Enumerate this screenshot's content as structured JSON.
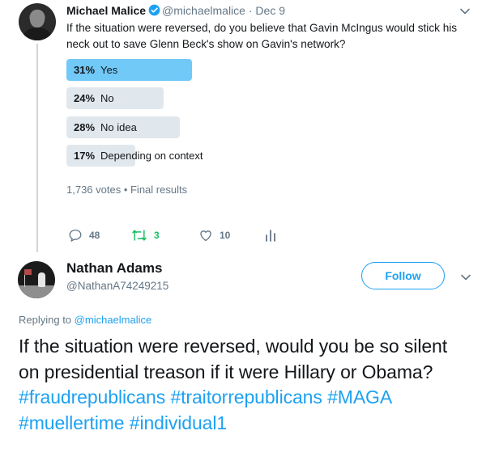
{
  "tweet1": {
    "author_name": "Michael Malice",
    "handle": "@michaelmalice",
    "separator": "·",
    "date": "Dec 9",
    "text": "If the situation were reversed, do you believe that Gavin McIngus would stick his neck out to save Glenn Beck's show on Gavin's network?",
    "poll": {
      "options": [
        {
          "percent": "31%",
          "label": "Yes",
          "fraction": 0.31,
          "winner": true
        },
        {
          "percent": "24%",
          "label": "No",
          "fraction": 0.24,
          "winner": false
        },
        {
          "percent": "28%",
          "label": "No idea",
          "fraction": 0.28,
          "winner": false
        },
        {
          "percent": "17%",
          "label": "Depending on context",
          "fraction": 0.17,
          "winner": false
        }
      ],
      "meta": "1,736 votes • Final results"
    },
    "actions": {
      "replies": "48",
      "retweets": "3",
      "likes": "10"
    },
    "icons": {
      "verified": "verified-badge-icon",
      "caret": "chevron-down-icon",
      "reply": "reply-icon",
      "retweet": "retweet-icon",
      "like": "heart-icon",
      "analytics": "analytics-icon"
    }
  },
  "tweet2": {
    "author_name": "Nathan Adams",
    "handle": "@NathanA74249215",
    "follow_label": "Follow",
    "replying_prefix": "Replying to",
    "replying_to": "@michaelmalice",
    "text_plain": "If the situation were reversed, would you be so silent on presidential treason if it were Hillary or Obama? ",
    "hashtags": [
      "#fraudrepublicans",
      "#traitorrepublicans",
      "#MAGA",
      "#muellertime",
      "#individual1"
    ]
  },
  "colors": {
    "accent": "#1da1f2",
    "poll_winner": "#71c9f8",
    "poll_other": "#e1e8ed",
    "retweet_green": "#17bf63",
    "secondary_text": "#657786"
  }
}
